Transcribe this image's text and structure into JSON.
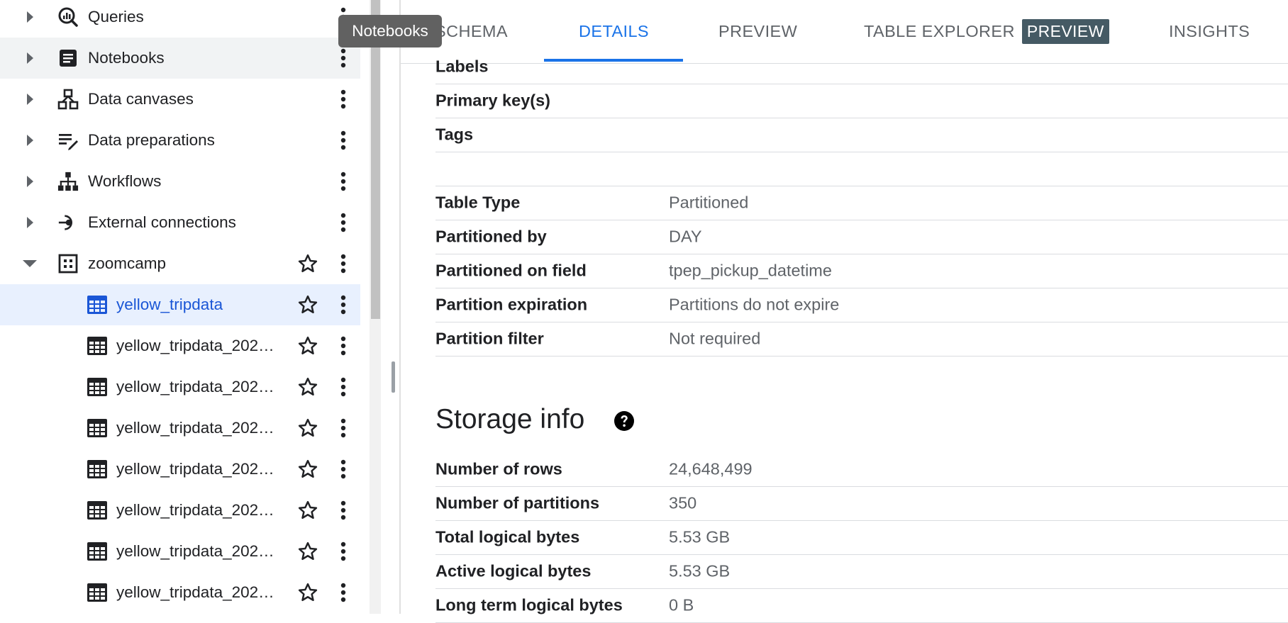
{
  "explorer": {
    "items": [
      {
        "label": "Queries",
        "icon": "queries-icon",
        "expanded": false
      },
      {
        "label": "Notebooks",
        "icon": "notebook-icon",
        "expanded": false
      },
      {
        "label": "Data canvases",
        "icon": "data-canvas-icon",
        "expanded": false
      },
      {
        "label": "Data preparations",
        "icon": "data-preparation-icon",
        "expanded": false
      },
      {
        "label": "Workflows",
        "icon": "workflow-icon",
        "expanded": false
      },
      {
        "label": "External connections",
        "icon": "external-connection-icon",
        "expanded": false
      },
      {
        "label": "zoomcamp",
        "icon": "dataset-icon",
        "expanded": true
      }
    ],
    "tables": [
      {
        "label": "yellow_tripdata",
        "selected": true
      },
      {
        "label": "yellow_tripdata_202…"
      },
      {
        "label": "yellow_tripdata_202…"
      },
      {
        "label": "yellow_tripdata_202…"
      },
      {
        "label": "yellow_tripdata_202…"
      },
      {
        "label": "yellow_tripdata_202…"
      },
      {
        "label": "yellow_tripdata_202…"
      },
      {
        "label": "yellow_tripdata_202…"
      }
    ]
  },
  "tooltip": {
    "text": "Notebooks"
  },
  "tabs": [
    {
      "label": "SCHEMA"
    },
    {
      "label": "DETAILS",
      "active": true
    },
    {
      "label": "PREVIEW"
    },
    {
      "label": "TABLE EXPLORER",
      "badge": "PREVIEW"
    },
    {
      "label": "INSIGHTS"
    }
  ],
  "details": {
    "rows": [
      {
        "label": "Labels",
        "value": ""
      },
      {
        "label": "Primary key(s)",
        "value": ""
      },
      {
        "label": "Tags",
        "value": ""
      }
    ],
    "partition_rows": [
      {
        "label": "Table Type",
        "value": "Partitioned"
      },
      {
        "label": "Partitioned by",
        "value": "DAY"
      },
      {
        "label": "Partitioned on field",
        "value": "tpep_pickup_datetime"
      },
      {
        "label": "Partition expiration",
        "value": "Partitions do not expire"
      },
      {
        "label": "Partition filter",
        "value": "Not required"
      }
    ]
  },
  "storage": {
    "title": "Storage info",
    "rows": [
      {
        "label": "Number of rows",
        "value": "24,648,499"
      },
      {
        "label": "Number of partitions",
        "value": "350"
      },
      {
        "label": "Total logical bytes",
        "value": "5.53 GB"
      },
      {
        "label": "Active logical bytes",
        "value": "5.53 GB"
      },
      {
        "label": "Long term logical bytes",
        "value": "0 B"
      }
    ]
  },
  "colors": {
    "accent": "#1a73e8",
    "selected_bg": "#e8f0fe",
    "tooltip_bg": "#616161",
    "badge_bg": "#455a64"
  }
}
